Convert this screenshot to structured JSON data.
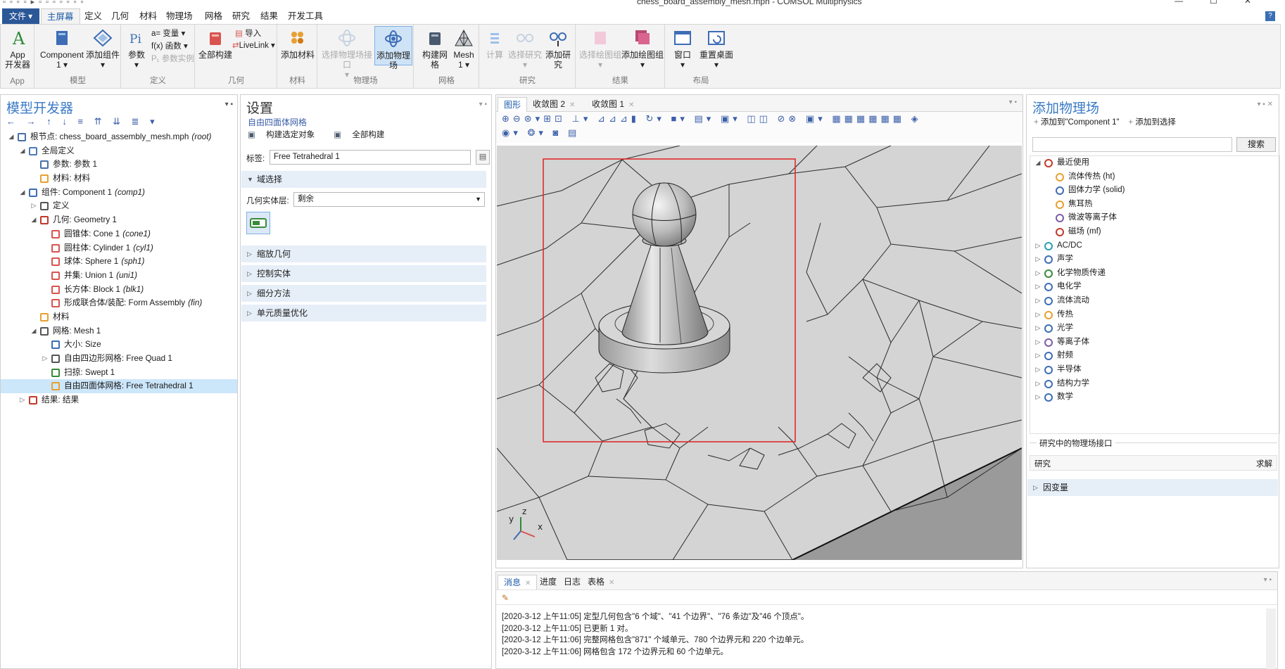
{
  "window": {
    "title": "chess_board_assembly_mesh.mph - COMSOL Multiphysics",
    "min": "—",
    "max": "☐",
    "close": "✕"
  },
  "ribbon_tabs": [
    "文件 ▾",
    "主屏幕",
    "定义",
    "几何",
    "材料",
    "物理场",
    "网格",
    "研究",
    "结果",
    "开发工具"
  ],
  "ribbon": {
    "app": "App\n开发器",
    "component": "Component\n1 ▾",
    "add_component": "添加组件\n▾",
    "params": "参数\n▾",
    "variables": "a= 变量 ▾",
    "functions": "f(x) 函数 ▾",
    "param_instance": "P₁ 参数实例",
    "build_all": "全部构建",
    "import": "导入",
    "livelink": "LiveLink ▾",
    "add_material": "添加材料",
    "select_physics_interface": "选择物理场接口\n▾",
    "add_physics": "添加物理场",
    "build_mesh": "构建网格",
    "mesh": "Mesh\n1 ▾",
    "compute": "计算",
    "select_study": "选择研究\n▾",
    "add_study": "添加研究",
    "select_plot_group": "选择绘图组\n▾",
    "add_plot_group": "添加绘图组\n▾",
    "window": "窗口\n▾",
    "reset_desktop": "重置桌面\n▾",
    "groups": [
      "App",
      "模型",
      "定义",
      "几何",
      "材料",
      "物理场",
      "网格",
      "研究",
      "结果",
      "布局"
    ]
  },
  "model_builder": {
    "title": "模型开发器",
    "tree": [
      {
        "depth": 0,
        "exp": "◢",
        "icon": "root-icon",
        "color": "#4a6fa8",
        "label": "根节点: chess_board_assembly_mesh.mph",
        "tag": "(root)"
      },
      {
        "depth": 1,
        "exp": "◢",
        "icon": "globe-icon",
        "color": "#4a7ab8",
        "label": "全局定义",
        "tag": ""
      },
      {
        "depth": 2,
        "exp": "",
        "icon": "param-icon",
        "color": "#4a6fa8",
        "label": "参数: 参数 1",
        "tag": ""
      },
      {
        "depth": 2,
        "exp": "",
        "icon": "material-icon",
        "color": "#e8a030",
        "label": "材料: 材料",
        "tag": ""
      },
      {
        "depth": 1,
        "exp": "◢",
        "icon": "component-icon",
        "color": "#3d6db5",
        "label": "组件: Component 1",
        "tag": "(comp1)"
      },
      {
        "depth": 2,
        "exp": "▷",
        "icon": "definitions-icon",
        "color": "#555",
        "label": "定义",
        "tag": ""
      },
      {
        "depth": 2,
        "exp": "◢",
        "icon": "geometry-icon",
        "color": "#c0392b",
        "label": "几何: Geometry 1",
        "tag": ""
      },
      {
        "depth": 3,
        "exp": "",
        "icon": "cone-icon",
        "color": "#d9534f",
        "label": "圆锥体: Cone 1",
        "tag": "(cone1)"
      },
      {
        "depth": 3,
        "exp": "",
        "icon": "cylinder-icon",
        "color": "#d9534f",
        "label": "圆柱体: Cylinder 1",
        "tag": "(cyl1)"
      },
      {
        "depth": 3,
        "exp": "",
        "icon": "sphere-icon",
        "color": "#d9534f",
        "label": "球体: Sphere 1",
        "tag": "(sph1)"
      },
      {
        "depth": 3,
        "exp": "",
        "icon": "union-icon",
        "color": "#d9534f",
        "label": "并集: Union 1",
        "tag": "(uni1)"
      },
      {
        "depth": 3,
        "exp": "",
        "icon": "block-icon",
        "color": "#d9534f",
        "label": "长方体: Block 1",
        "tag": "(blk1)"
      },
      {
        "depth": 3,
        "exp": "",
        "icon": "form-assembly-icon",
        "color": "#d9534f",
        "label": "形成联合体/装配: Form Assembly",
        "tag": "(fin)"
      },
      {
        "depth": 2,
        "exp": "",
        "icon": "material-icon",
        "color": "#e8a030",
        "label": "材料",
        "tag": ""
      },
      {
        "depth": 2,
        "exp": "◢",
        "icon": "mesh-icon",
        "color": "#555",
        "label": "网格: Mesh 1",
        "tag": ""
      },
      {
        "depth": 3,
        "exp": "",
        "icon": "size-icon",
        "color": "#3d6db5",
        "label": "大小: Size",
        "tag": ""
      },
      {
        "depth": 3,
        "exp": "▷",
        "icon": "free-quad-icon",
        "color": "#555",
        "label": "自由四边形网格: Free Quad 1",
        "tag": ""
      },
      {
        "depth": 3,
        "exp": "",
        "icon": "swept-icon",
        "color": "#3a8a3a",
        "label": "扫掠: Swept 1",
        "tag": ""
      },
      {
        "depth": 3,
        "exp": "",
        "icon": "free-tetrahedral-icon",
        "color": "#e8a030",
        "label": "自由四面体网格: Free Tetrahedral 1",
        "tag": "",
        "selected": true
      },
      {
        "depth": 1,
        "exp": "▷",
        "icon": "results-icon",
        "color": "#c0392b",
        "label": "结果: 结果",
        "tag": ""
      }
    ]
  },
  "settings": {
    "title": "设置",
    "subtitle": "自由四面体网格",
    "build_selected": "构建选定对象",
    "build_all": "全部构建",
    "label_caption": "标签:",
    "label_value": "Free Tetrahedral 1",
    "domain_selection": "域选择",
    "geom_entity_level_caption": "几何实体层:",
    "geom_entity_level_value": "剩余",
    "sections": [
      "缩放几何",
      "控制实体",
      "细分方法",
      "单元质量优化"
    ]
  },
  "graphics": {
    "tabs": [
      "图形",
      "收敛图 2",
      "收敛图 1"
    ],
    "axis_x": "x",
    "axis_y": "y",
    "axis_z": "z"
  },
  "physics": {
    "title": "添加物理场",
    "add_to": "添加到\"Component 1\"",
    "add_to_selection": "添加到选择",
    "search_btn": "搜索",
    "list": [
      {
        "depth": 0,
        "exp": "◢",
        "icon": "recent-icon",
        "color": "#c0392b",
        "label": "最近使用"
      },
      {
        "depth": 1,
        "exp": "",
        "icon": "heat-fluid-icon",
        "color": "#e8a030",
        "label": "流体传热 (ht)"
      },
      {
        "depth": 1,
        "exp": "",
        "icon": "solid-mechanics-icon",
        "color": "#3d6db5",
        "label": "固体力学 (solid)"
      },
      {
        "depth": 1,
        "exp": "",
        "icon": "joule-heating-icon",
        "color": "#e8a030",
        "label": "焦耳热"
      },
      {
        "depth": 1,
        "exp": "",
        "icon": "microwave-plasma-icon",
        "color": "#7d5ba6",
        "label": "微波等离子体"
      },
      {
        "depth": 1,
        "exp": "",
        "icon": "magnetic-field-icon",
        "color": "#c0392b",
        "label": "磁场 (mf)"
      },
      {
        "depth": 0,
        "exp": "▷",
        "icon": "acdc-icon",
        "color": "#2a9fb5",
        "label": "AC/DC"
      },
      {
        "depth": 0,
        "exp": "▷",
        "icon": "acoustics-icon",
        "color": "#3d6db5",
        "label": "声学"
      },
      {
        "depth": 0,
        "exp": "▷",
        "icon": "chem-transport-icon",
        "color": "#3a8a3a",
        "label": "化学物质传递"
      },
      {
        "depth": 0,
        "exp": "▷",
        "icon": "electrochemistry-icon",
        "color": "#3d6db5",
        "label": "电化学"
      },
      {
        "depth": 0,
        "exp": "▷",
        "icon": "fluid-flow-icon",
        "color": "#3d6db5",
        "label": "流体流动"
      },
      {
        "depth": 0,
        "exp": "▷",
        "icon": "heat-transfer-icon",
        "color": "#e8a030",
        "label": "传热"
      },
      {
        "depth": 0,
        "exp": "▷",
        "icon": "optics-icon",
        "color": "#3d6db5",
        "label": "光学"
      },
      {
        "depth": 0,
        "exp": "▷",
        "icon": "plasma-icon",
        "color": "#7d5ba6",
        "label": "等离子体"
      },
      {
        "depth": 0,
        "exp": "▷",
        "icon": "rf-icon",
        "color": "#3d6db5",
        "label": "射频"
      },
      {
        "depth": 0,
        "exp": "▷",
        "icon": "semiconductor-icon",
        "color": "#3d6db5",
        "label": "半导体"
      },
      {
        "depth": 0,
        "exp": "▷",
        "icon": "structural-icon",
        "color": "#3d6db5",
        "label": "结构力学"
      },
      {
        "depth": 0,
        "exp": "▷",
        "icon": "math-icon",
        "color": "#3d6db5",
        "label": "数学"
      }
    ],
    "study_interfaces_title": "研究中的物理场接口",
    "study_col": "研究",
    "solve_col": "求解",
    "dependent_vars": "因变量"
  },
  "messages": {
    "tabs": [
      "消息",
      "进度",
      "日志",
      "表格"
    ],
    "lines": [
      "[2020-3-12 上午11:05] 定型几何包含\"6 个域\"、\"41 个边界\"、\"76 条边\"及\"46 个顶点\"。",
      "[2020-3-12 上午11:05] 已更新 1 对。",
      "[2020-3-12 上午11:06] 完整网格包含\"871\" 个域单元、780 个边界元和 220 个边单元。",
      "[2020-3-12 上午11:06] 网格包含 172 个边界元和 60 个边单元。"
    ]
  },
  "colors": {
    "accent": "#3b7ac6",
    "file_tab": "#2b5797",
    "selection": "#cce6fa",
    "highlight_box": "#e0201e"
  }
}
